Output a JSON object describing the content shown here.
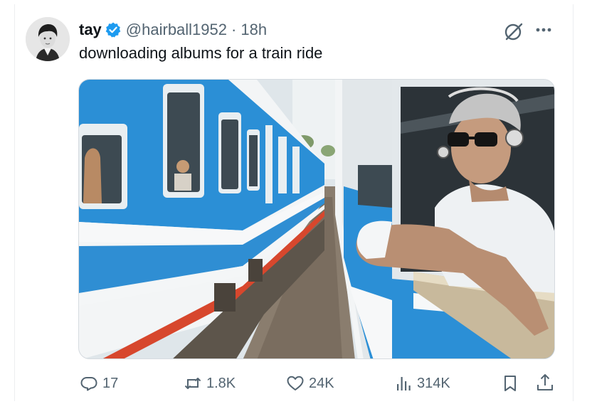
{
  "tweet": {
    "display_name": "tay",
    "verified": true,
    "handle": "@hairball1952",
    "separator": "·",
    "time": "18h",
    "text": "downloading albums for a train ride"
  },
  "icons": {
    "avatar": "avatar-photo",
    "verified": "verified-badge-icon",
    "grok": "grok-icon",
    "more": "more-dots-icon",
    "reply": "reply-icon",
    "repost": "repost-icon",
    "like": "heart-icon",
    "views": "views-chart-icon",
    "bookmark": "bookmark-icon",
    "share": "share-icon"
  },
  "stats": {
    "replies": "17",
    "reposts": "1.8K",
    "likes": "24K",
    "views": "314K"
  },
  "colors": {
    "accent": "#1d9bf0",
    "text_primary": "#0f1419",
    "text_secondary": "#536471",
    "train_blue": "#2b8fd6"
  }
}
